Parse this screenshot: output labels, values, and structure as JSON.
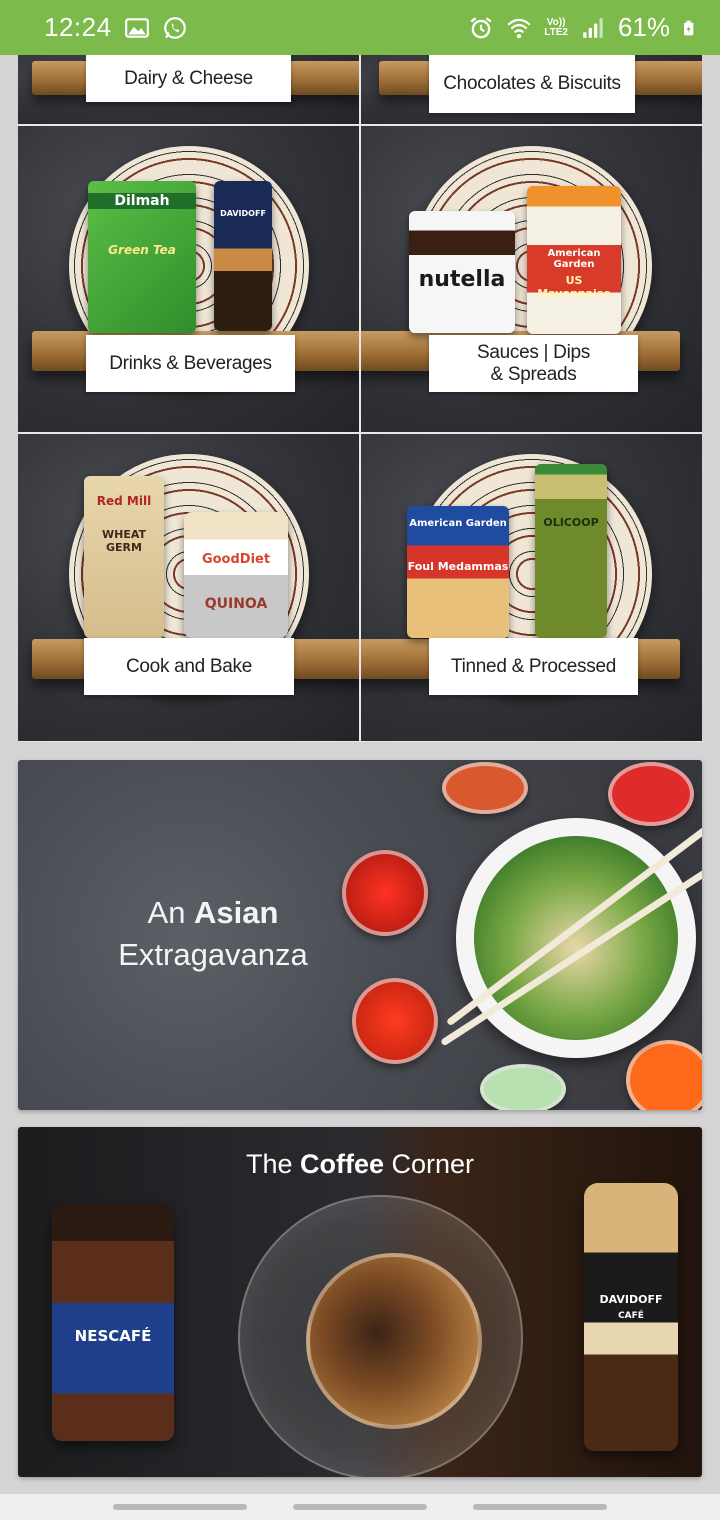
{
  "status_bar": {
    "time": "12:24",
    "battery": "61%",
    "network_line1": "Vo))",
    "network_line2": "LTE2",
    "icons": [
      "gallery-icon",
      "whatsapp-icon",
      "alarm-icon",
      "wifi-icon",
      "signal-icon",
      "battery-icon"
    ],
    "background_color": "#7cba4c"
  },
  "categories": [
    {
      "label": "Dairy & Cheese"
    },
    {
      "label": "Chocolates & Biscuits"
    },
    {
      "label": "Drinks & Beverages"
    },
    {
      "label_line1": "Sauces | Dips",
      "label_line2": "& Spreads"
    },
    {
      "label": "Cook and Bake"
    },
    {
      "label": "Tinned & Processed"
    }
  ],
  "products": {
    "dilmah": "Dilmah",
    "green_tea": "Green Tea",
    "davidoff": "DAVIDOFF",
    "nutella": "nutella",
    "american_garden": "American Garden",
    "us_mayonnaise": "US Mayonnaise",
    "red_mill": "Red Mill",
    "wheat_germ": "WHEAT GERM",
    "gooddiet": "GoodDiet",
    "quinoa": "QUINOA",
    "foul_medammas": "Foul Medammas",
    "olicoop": "OLICOOP"
  },
  "banners": {
    "asian": {
      "title_regular": "An ",
      "title_bold": "Asian",
      "subtitle": "Extragavanza"
    },
    "coffee": {
      "title_regular": "The ",
      "title_bold": "Coffee",
      "title_end": " Corner",
      "nescafe": "NESCAFÉ",
      "davidoff": "DAVIDOFF",
      "davidoff_cafe": "CAFÉ"
    }
  }
}
